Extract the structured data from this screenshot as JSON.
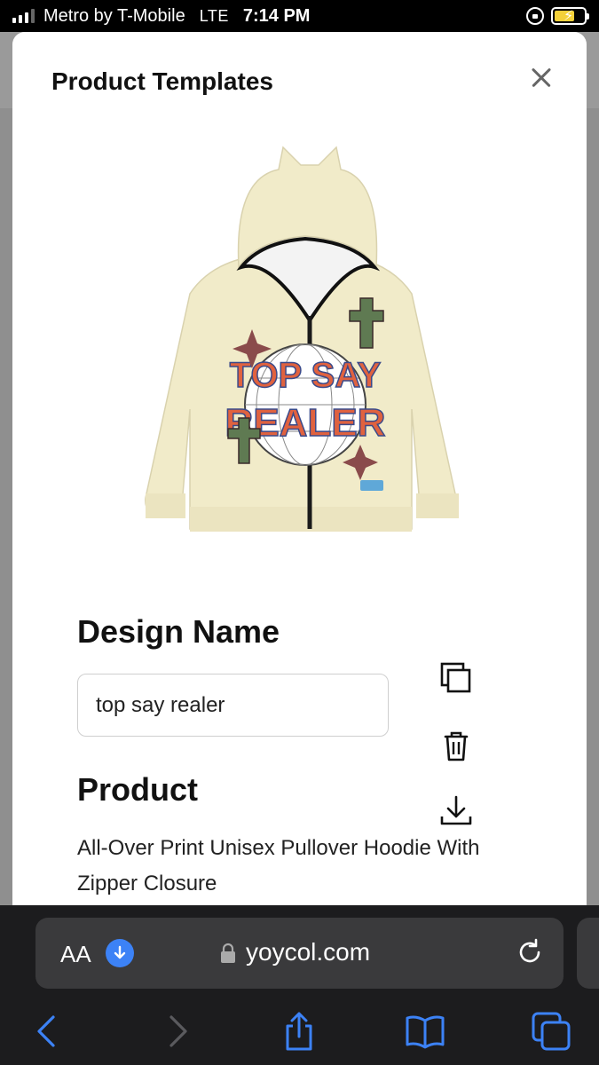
{
  "status_bar": {
    "carrier": "Metro by T-Mobile",
    "network": "LTE",
    "time": "7:14 PM"
  },
  "modal": {
    "title": "Product Templates",
    "design_name_label": "Design Name",
    "design_name_value": "top say realer",
    "product_label": "Product",
    "product_description": "All-Over Print Unisex Pullover Hoodie With Zipper Closure"
  },
  "product_image": {
    "graphic_lines": [
      "TOP SAY",
      "REALER"
    ],
    "colors": {
      "hoodie": "#f1ebc9",
      "zipper": "#1a1a1a",
      "text": "#e0623f",
      "cross": "#5f7a52",
      "star": "#8a4b4b"
    }
  },
  "browser": {
    "text_size_label": "AA",
    "url": "yoycol.com"
  },
  "colors": {
    "accent": "#3c82f6",
    "toolbar": "#1c1c1e"
  }
}
